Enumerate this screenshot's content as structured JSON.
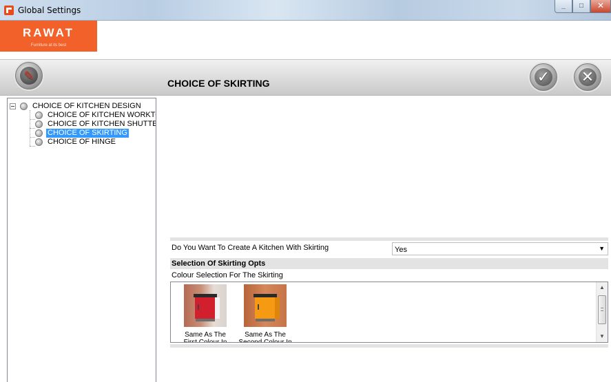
{
  "window": {
    "title": "Global Settings",
    "minimize_icon": "minimize-icon",
    "maximize_icon": "maximize-icon",
    "close_icon": "close-icon"
  },
  "logo": {
    "name": "RAWAT",
    "tagline": "Furniture at its best",
    "color": "#f2612a"
  },
  "header": {
    "page_title": "CHOICE OF SKIRTING",
    "settings_icon": "tools-icon",
    "ok_icon": "check-icon",
    "cancel_icon": "x-icon"
  },
  "tree": {
    "root": {
      "label": "CHOICE OF KITCHEN DESIGN",
      "expanded": true
    },
    "children": [
      {
        "label": "CHOICE OF KITCHEN WORKTOP",
        "selected": false
      },
      {
        "label": "CHOICE OF KITCHEN SHUTTER DESIGN",
        "selected": false
      },
      {
        "label": "CHOICE OF SKIRTING",
        "selected": true
      },
      {
        "label": "CHOICE OF HINGE",
        "selected": false
      }
    ],
    "selection_color": "#3399ff"
  },
  "options": {
    "skirting_question": "Do You Want To Create A Kitchen With Skirting",
    "skirting_value": "Yes",
    "section_title": "Selection Of Skirting Opts",
    "colour_label": "Colour Selection For The Skirting",
    "colour_options": [
      {
        "caption": "Same As The First Colour In The Colour Palette",
        "cabinet_color": "#d21f2e"
      },
      {
        "caption": "Same As The Second Colour In The Colour Palette",
        "cabinet_color": "#f59a12"
      }
    ]
  }
}
